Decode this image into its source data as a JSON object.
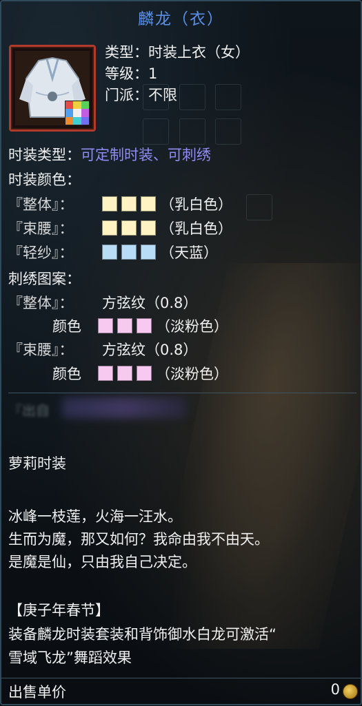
{
  "item": {
    "title": "麟龙（衣）",
    "type_line": "类型：时装上衣（女）",
    "level_line": "等级：1",
    "faction_line": "门派：不限"
  },
  "props": {
    "fashion_type_label": "时装类型：",
    "fashion_type_value": "可定制时装、可刺绣",
    "fashion_color_label": "时装颜色：",
    "colors": [
      {
        "part": "『整体』：",
        "name": "（乳白色）",
        "hex": "#fff3c4"
      },
      {
        "part": "『束腰』：",
        "name": "（乳白色）",
        "hex": "#fff3c4"
      },
      {
        "part": "『轻纱』：",
        "name": "（天蓝）",
        "hex": "#b9dcf6"
      }
    ],
    "embroidery_label": "刺绣图案：",
    "embroidery": [
      {
        "part": "『整体』：",
        "pattern": "方弦纹（0.8）",
        "color_label": "颜色",
        "color_name": "（淡粉色）",
        "hex": "#f7c8f0"
      },
      {
        "part": "『束腰』：",
        "pattern": "方弦纹（0.8）",
        "color_label": "颜色",
        "color_name": "（淡粉色）",
        "hex": "#f7c8f0"
      }
    ]
  },
  "blurred_text": "『出自",
  "category_tag": "萝莉时装",
  "lore": [
    "冰峰一枝莲，火海一汪水。",
    "生而为魔，那又如何？我命由我不由天。",
    "是魔是仙，只由我自己决定。"
  ],
  "event": {
    "title": "【庚子年春节】",
    "line1": "装备麟龙时装套装和背饰御水白龙可激活“",
    "line2": "雪域飞龙”舞蹈效果"
  },
  "sell": {
    "label": "出售单价",
    "value": "0"
  },
  "palette_colors": [
    "#e84a4a",
    "#f0d040",
    "#5ad05a",
    "#50a0f0",
    "#f0f0f0",
    "#c060e0",
    "#f08a30",
    "#40d0d0",
    "#7070f0"
  ]
}
